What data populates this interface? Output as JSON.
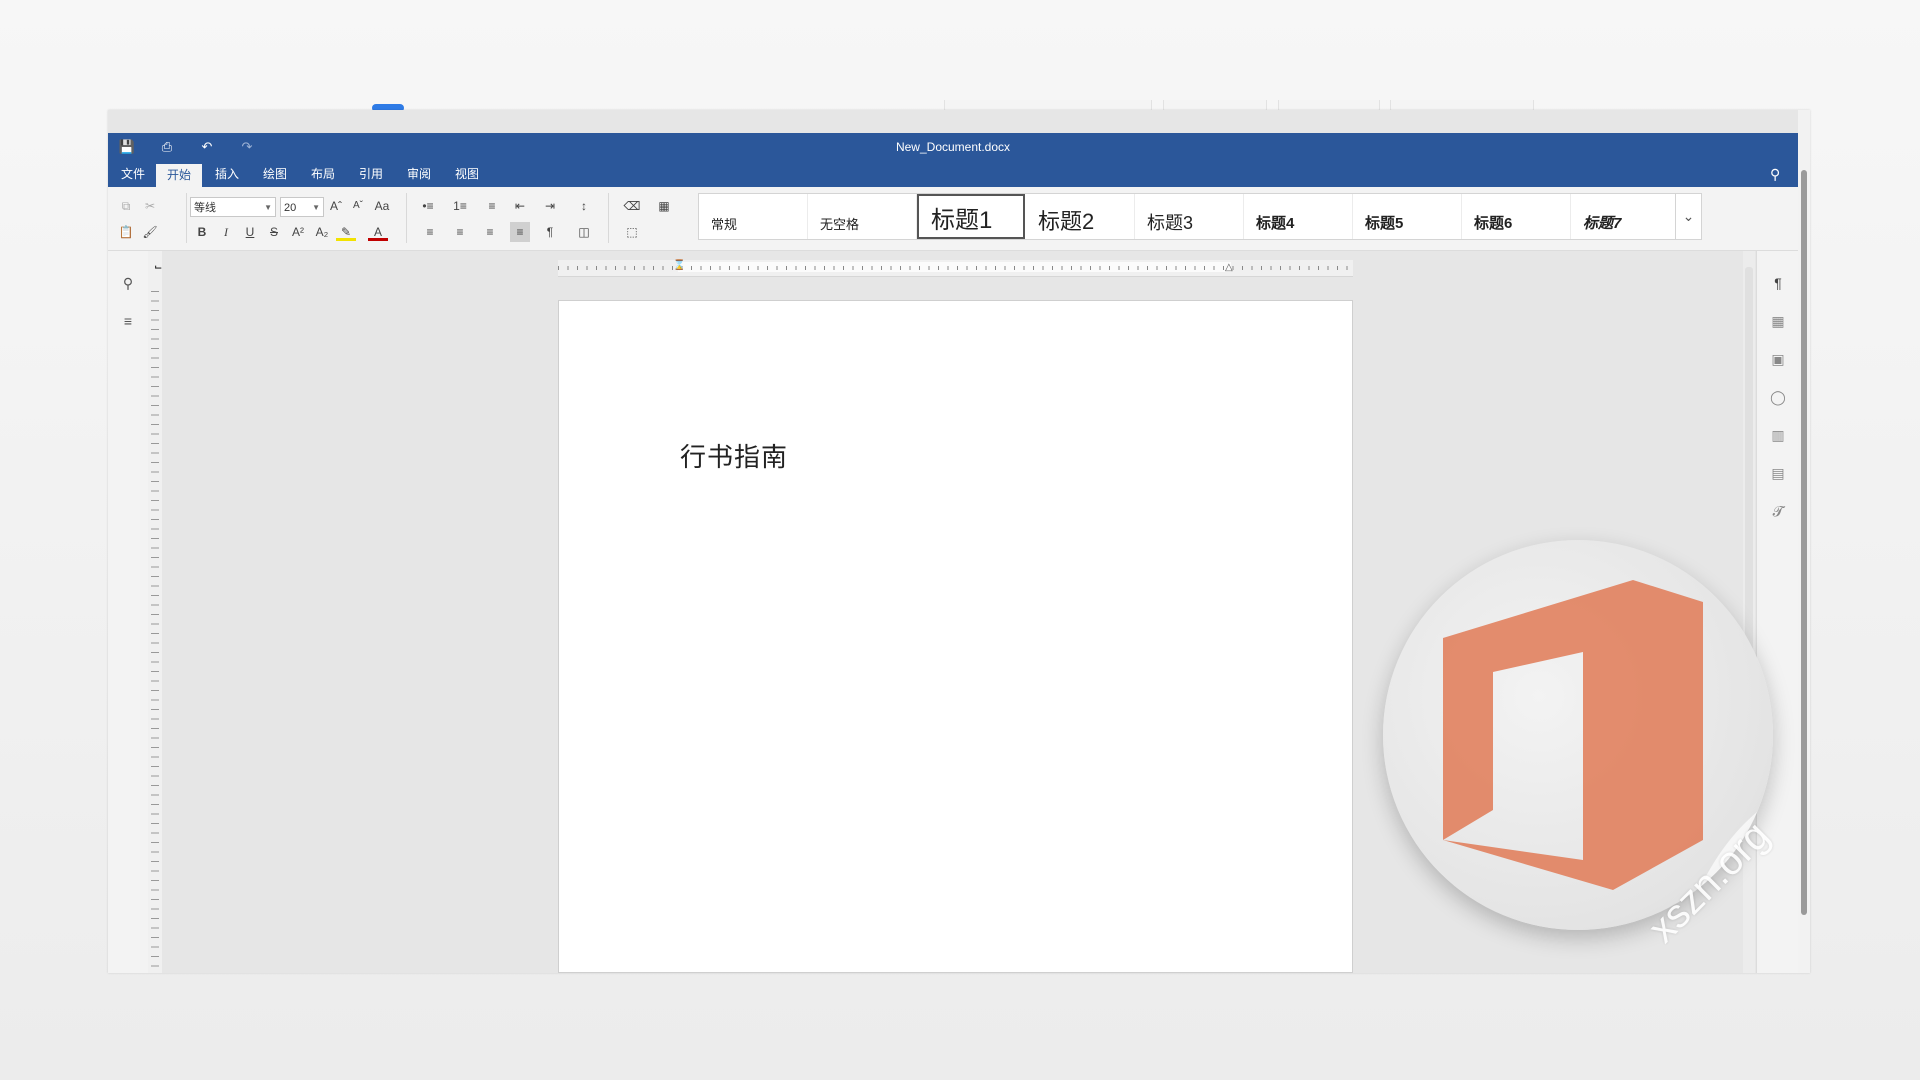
{
  "window": {
    "title": "New_Document.docx"
  },
  "menu": [
    "文件",
    "开始",
    "插入",
    "绘图",
    "布局",
    "引用",
    "审阅",
    "视图"
  ],
  "active_menu": "开始",
  "font": {
    "name": "等线",
    "size": "20"
  },
  "styles": [
    "常规",
    "无空格",
    "标题1",
    "标题2",
    "标题3",
    "标题4",
    "标题5",
    "标题6",
    "标题7"
  ],
  "document": {
    "text": "行书指南"
  },
  "watermark": {
    "text": "xszn.org"
  },
  "colors": {
    "titlebar": "#2b579a",
    "accent_logo": "#e07a56"
  }
}
